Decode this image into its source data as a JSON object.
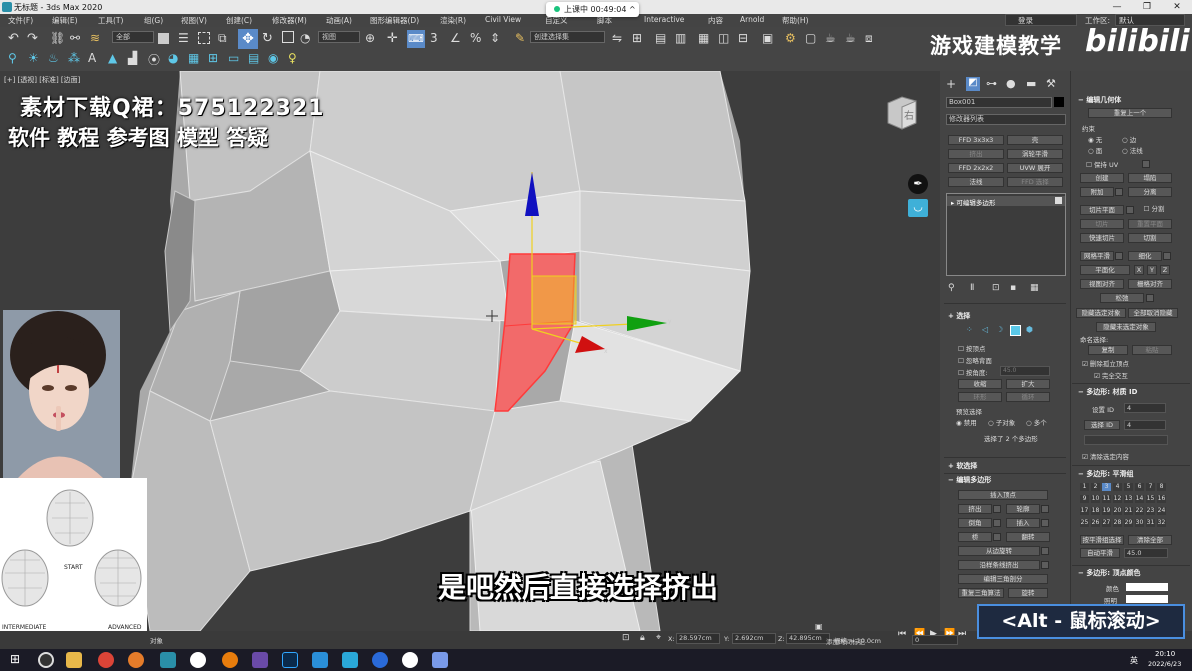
{
  "window": {
    "title": "无标题 - 3ds Max 2020",
    "min": "—",
    "max": "❐",
    "close": "✕"
  },
  "recording": {
    "label": "上课中 00:49:04",
    "chevron": "^"
  },
  "menu": [
    "文件(F)",
    "编辑(E)",
    "工具(T)",
    "组(G)",
    "视图(V)",
    "创建(C)",
    "修改器(M)",
    "动画(A)",
    "图形编辑器(D)",
    "渲染(R)",
    "Civil View",
    "自定义",
    "脚本",
    "Interactive",
    "内容",
    "Arnold",
    "帮助(H)"
  ],
  "menu_extra": {
    "login": "登录",
    "workspace_label": "工作区:",
    "workspace_value": "默认"
  },
  "toolbar": {
    "select_filter": "全部",
    "view_dropdown": "视图",
    "selection_set": "创建选择集"
  },
  "brand": {
    "text": "游戏建模教学",
    "logo": "bilibili"
  },
  "viewport": {
    "label": "[+] [透视] [标准] [边面]",
    "cube_face": "右"
  },
  "overlay": {
    "line1": "素材下载Q裙：575122321",
    "line2": "软件 教程 参考图 模型 答疑"
  },
  "subtitle": "是吧然后直接选择挤出",
  "alt_hint": "<Alt - 鼠标滚动>",
  "ref": {
    "start": "START",
    "intermediate": "INTERMEDIATE",
    "advanced": "ADVANCED"
  },
  "modifier": {
    "object_name": "Box001",
    "modifier_list": "修改器列表",
    "buttons": [
      "FFD 3x3x3",
      "壳",
      "挤出",
      "涡轮平滑",
      "FFD 2x2x2",
      "UVW 展开",
      "法线",
      "FFD 选择"
    ],
    "stack_item": "可编辑多边形",
    "selection_title": "选择",
    "by_vertex": "按顶点",
    "ignore_back": "忽略背面",
    "by_angle": "按角度:",
    "angle_value": "45.0",
    "shrink": "收缩",
    "grow": "扩大",
    "ring": "环形",
    "loop": "循环",
    "preview_title": "预览选择",
    "preview_off": "禁用",
    "preview_sub": "子对象",
    "preview_multi": "多个",
    "selected_count": "选择了 2 个多边形",
    "soft_title": "软选择",
    "edit_poly_title": "编辑多边形",
    "insert_vertex": "插入顶点",
    "extrude": "挤出",
    "outline": "轮廓",
    "bevel": "倒角",
    "inset": "插入",
    "bridge": "桥",
    "flip": "翻转",
    "hinge": "从边旋转",
    "extrude_spline": "沿样条线挤出",
    "edit_tri": "编辑三角剖分",
    "retri": "重复三角算法",
    "turn": "旋转"
  },
  "geometry": {
    "title": "编辑几何体",
    "repeat_last": "重复上一个",
    "constraints": "约束",
    "c_none": "无",
    "c_edge": "边",
    "c_face": "面",
    "c_normal": "法线",
    "preserve_uv": "保持 UV",
    "create": "创建",
    "collapse": "塌陷",
    "attach": "附加",
    "detach": "分离",
    "slice_plane": "切片平面",
    "split": "分割",
    "slice": "切片",
    "reset_plane": "重置平面",
    "quickslice": "快速切片",
    "cut": "切割",
    "meshsmooth": "网格平滑",
    "tessellate": "细化",
    "make_planar": "平面化",
    "x": "X",
    "y": "Y",
    "z": "Z",
    "view_align": "视图对齐",
    "grid_align": "栅格对齐",
    "relax": "松弛",
    "hide_sel": "隐藏选定对象",
    "unhide_all": "全部取消隐藏",
    "hide_unsel": "隐藏未选定对象",
    "named_sel": "命名选择:",
    "copy": "复制",
    "paste": "粘贴",
    "delete_iso": "删除孤立顶点",
    "full_interact": "完全交互",
    "matid_title": "多边形: 材质 ID",
    "set_id": "设置 ID",
    "set_id_val": "4",
    "select_id": "选择 ID",
    "select_id_val": "4",
    "clear_sel": "清除选定内容",
    "smooth_title": "多边形: 平滑组",
    "sg": [
      "1",
      "2",
      "3",
      "4",
      "5",
      "6",
      "7",
      "8",
      "9",
      "10",
      "11",
      "12",
      "13",
      "14",
      "15",
      "16",
      "17",
      "18",
      "19",
      "20",
      "21",
      "22",
      "23",
      "24",
      "25",
      "26",
      "27",
      "28",
      "29",
      "30",
      "31",
      "32"
    ],
    "select_by_sg": "按平滑组选择",
    "clear_all": "清除全部",
    "autosmooth": "自动平滑",
    "autosmooth_val": "45.0",
    "vcolor_title": "多边形: 顶点颜色",
    "color": "颜色",
    "illum": "照明"
  },
  "status": {
    "x_label": "X:",
    "x": "28.597cm",
    "y_label": "Y:",
    "y": "2.692cm",
    "z_label": "Z:",
    "z": "42.895cm",
    "grid": "栅格 = 10.0cm",
    "add_tag": "添加时间标记",
    "frame": "0",
    "select_label": "对象"
  },
  "taskbar": {
    "time": "20:10",
    "date": "2022/6/23",
    "lang": "英"
  },
  "colors": {
    "selected_poly": "#f26a6a",
    "axis_x": "#d01010",
    "axis_y": "#10a010",
    "axis_z": "#1010c0",
    "gizmo": "#f0d020"
  }
}
